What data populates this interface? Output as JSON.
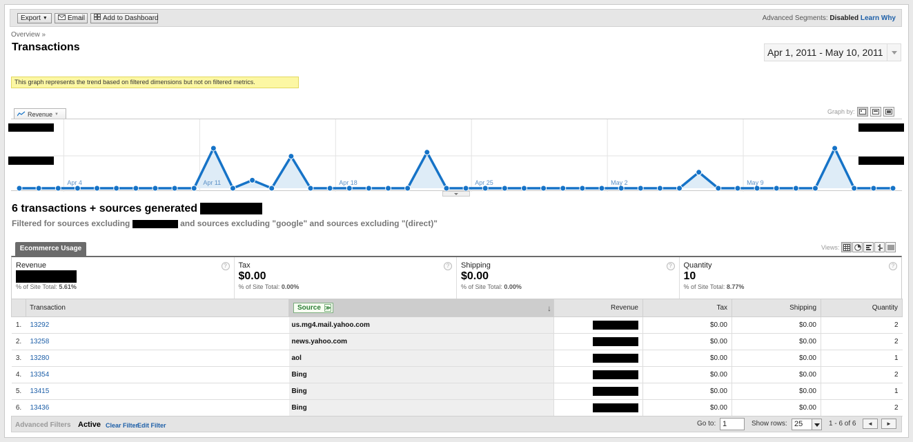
{
  "toolbar": {
    "export_label": "Export",
    "email_label": "Email",
    "dashboard_label": "Add to Dashboard",
    "segments_label": "Advanced Segments:",
    "segments_value": "Disabled",
    "learn_why": "Learn Why"
  },
  "breadcrumb": "Overview »",
  "page_title": "Transactions",
  "date_range": "Apr 1, 2011 - May 10, 2011",
  "notice": "This graph represents the trend based on filtered dimensions but not on filtered metrics.",
  "graph": {
    "metric_label": "Revenue",
    "graph_by_label": "Graph by:"
  },
  "chart_data": {
    "type": "area",
    "series": [
      {
        "name": "Revenue",
        "values": [
          0,
          0,
          0,
          0,
          0,
          0,
          0,
          0,
          0,
          0,
          1,
          0,
          0.2,
          0,
          0.8,
          0,
          0,
          0,
          0,
          0,
          0,
          0.9,
          0,
          0,
          0,
          0,
          0,
          0,
          0,
          0,
          0,
          0,
          0,
          0,
          0,
          0.4,
          0,
          0,
          0,
          0,
          0,
          0,
          1,
          0,
          0,
          0
        ]
      }
    ],
    "x_tick_labels": [
      "Apr 4",
      "Apr 11",
      "Apr 18",
      "Apr 25",
      "May 2",
      "May 9"
    ],
    "x_tick_indices": [
      3,
      10,
      17,
      24,
      31,
      38
    ],
    "color": "#1673c7",
    "fill_color": "#deecf7",
    "grid": true
  },
  "summary": {
    "headline": "6 transactions + sources generated",
    "filter_prefix": "Filtered for sources excluding",
    "filter_suffix": "and sources excluding \"google\" and sources excluding \"(direct)\""
  },
  "ecommerce_tab": "Ecommerce Usage",
  "views_label": "Views:",
  "scorecards": [
    {
      "label": "Revenue",
      "value": "",
      "pct_label": "% of Site Total:",
      "pct": "5.61%"
    },
    {
      "label": "Tax",
      "value": "$0.00",
      "pct_label": "% of Site Total:",
      "pct": "0.00%"
    },
    {
      "label": "Shipping",
      "value": "$0.00",
      "pct_label": "% of Site Total:",
      "pct": "0.00%"
    },
    {
      "label": "Quantity",
      "value": "10",
      "pct_label": "% of Site Total:",
      "pct": "8.77%"
    }
  ],
  "table": {
    "headers": {
      "transaction": "Transaction",
      "source": "Source",
      "revenue": "Revenue",
      "tax": "Tax",
      "shipping": "Shipping",
      "quantity": "Quantity"
    },
    "rows": [
      {
        "idx": "1.",
        "id": "13292",
        "source": "us.mg4.mail.yahoo.com",
        "tax": "$0.00",
        "shipping": "$0.00",
        "qty": "2"
      },
      {
        "idx": "2.",
        "id": "13258",
        "source": "news.yahoo.com",
        "tax": "$0.00",
        "shipping": "$0.00",
        "qty": "2"
      },
      {
        "idx": "3.",
        "id": "13280",
        "source": "aol",
        "tax": "$0.00",
        "shipping": "$0.00",
        "qty": "1"
      },
      {
        "idx": "4.",
        "id": "13354",
        "source": "Bing",
        "tax": "$0.00",
        "shipping": "$0.00",
        "qty": "2"
      },
      {
        "idx": "5.",
        "id": "13415",
        "source": "Bing",
        "tax": "$0.00",
        "shipping": "$0.00",
        "qty": "1"
      },
      {
        "idx": "6.",
        "id": "13436",
        "source": "Bing",
        "tax": "$0.00",
        "shipping": "$0.00",
        "qty": "2"
      }
    ]
  },
  "footer": {
    "advanced_filters": "Advanced Filters",
    "active": "Active",
    "clear_filter": "Clear Filter",
    "edit_filter": "Edit Filter",
    "goto_label": "Go to:",
    "goto_value": "1",
    "show_rows_label": "Show rows:",
    "show_rows_value": "25",
    "pagination": "1 - 6 of 6"
  }
}
